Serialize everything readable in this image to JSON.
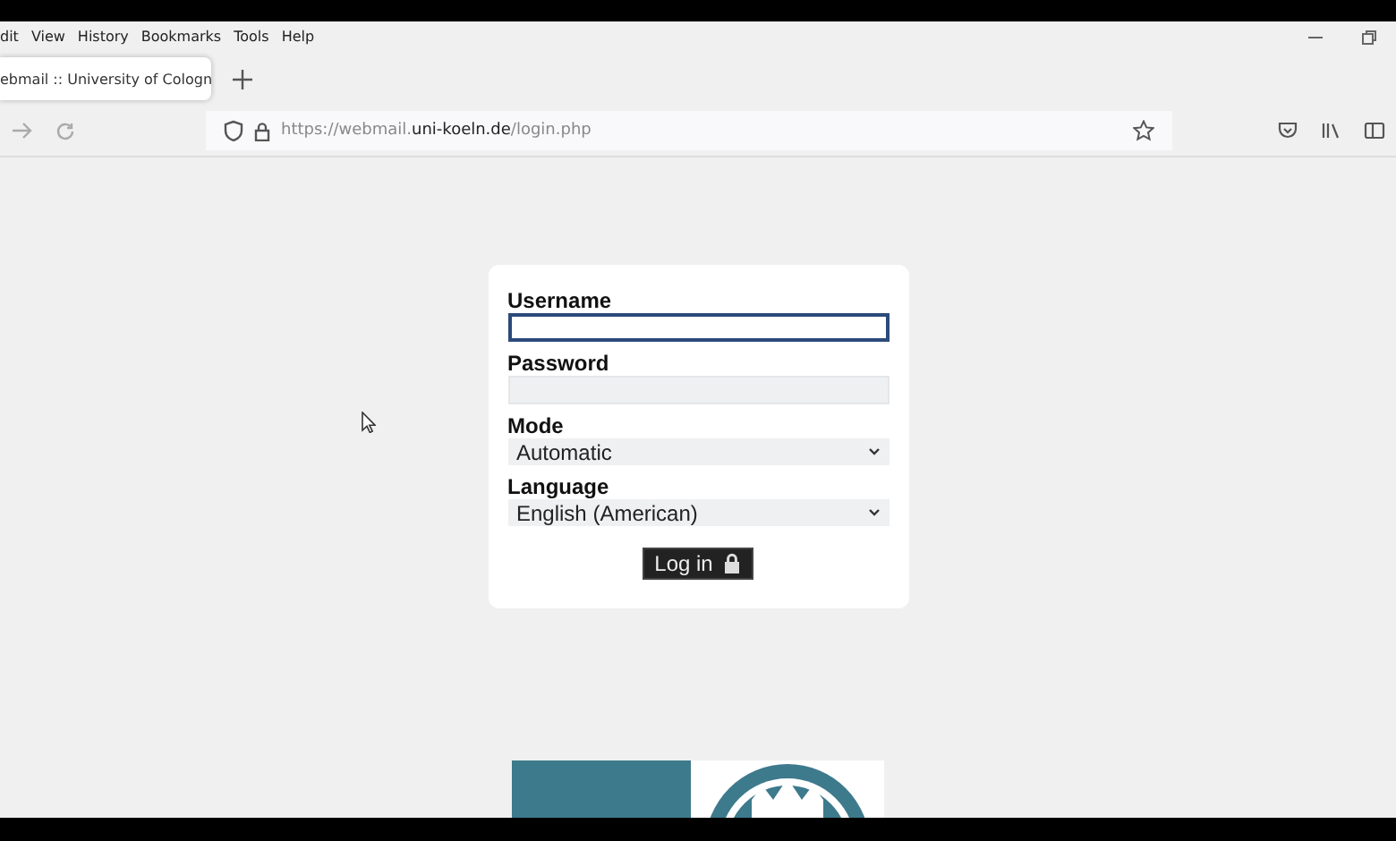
{
  "menu_bar": {
    "items": [
      "dit",
      "View",
      "History",
      "Bookmarks",
      "Tools",
      "Help"
    ]
  },
  "tabs": [
    {
      "title": "ebmail :: University of Cologn",
      "selected": true
    }
  ],
  "address_bar": {
    "url": "https://webmail.**uni-koeln.de**/login.php"
  },
  "login_form": {
    "fields": [
      {
        "kind": "text",
        "label": "Username",
        "focused": true
      },
      {
        "kind": "password",
        "label": "Password",
        "focused": false
      },
      {
        "kind": "select",
        "label": "Mode",
        "value": "Automatic"
      },
      {
        "kind": "select",
        "label": "Language",
        "value": "English (American)"
      }
    ],
    "submit": {
      "label": "Log in"
    }
  }
}
